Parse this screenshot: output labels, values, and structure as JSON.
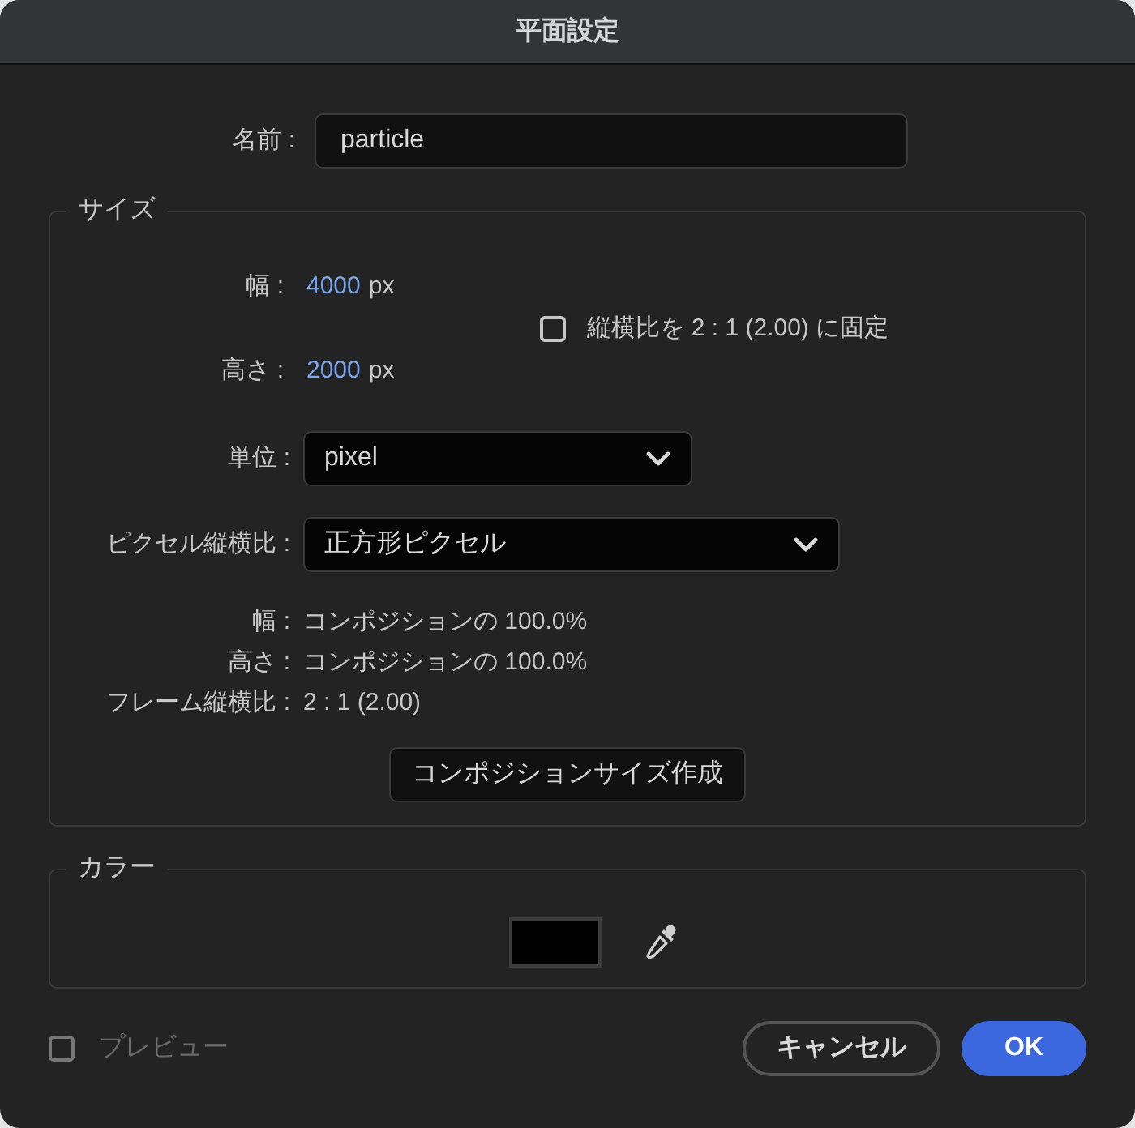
{
  "window": {
    "title": "平面設定"
  },
  "name": {
    "label": "名前 :",
    "value": "particle"
  },
  "size": {
    "legend": "サイズ",
    "width": {
      "label": "幅 :",
      "value": "4000",
      "unit": "px"
    },
    "height": {
      "label": "高さ :",
      "value": "2000",
      "unit": "px"
    },
    "lock_aspect": {
      "label": "縦横比を 2 : 1 (2.00) に固定",
      "checked": false
    },
    "units": {
      "label": "単位 :",
      "value": "pixel"
    },
    "pixel_aspect": {
      "label": "ピクセル縦横比 :",
      "value": "正方形ピクセル"
    },
    "info": [
      {
        "label": "幅 :",
        "value": "コンポジションの 100.0%"
      },
      {
        "label": "高さ :",
        "value": "コンポジションの 100.0%"
      },
      {
        "label": "フレーム縦横比 :",
        "value": "2 : 1 (2.00)"
      }
    ],
    "comp_size_button": "コンポジションサイズ作成"
  },
  "color": {
    "legend": "カラー",
    "color": "#000000"
  },
  "preview": {
    "label": "プレビュー",
    "checked": false,
    "disabled": true
  },
  "buttons": [
    {
      "label": "キャンセル",
      "kind": "secondary"
    },
    {
      "label": "OK",
      "kind": "primary"
    }
  ]
}
